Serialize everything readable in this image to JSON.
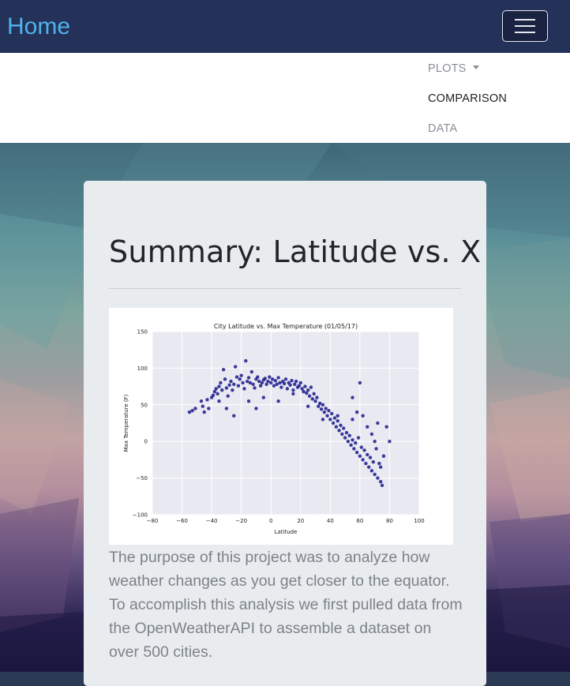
{
  "navbar": {
    "brand": "Home",
    "toggler_icon": "hamburger-icon",
    "menu": [
      {
        "label": "PLOTS",
        "dropdown": true
      },
      {
        "label": "COMPARISON",
        "dropdown": false
      },
      {
        "label": "DATA",
        "dropdown": false
      }
    ]
  },
  "main": {
    "title": "Summary: Latitude vs. X",
    "description": "The purpose of this project was to analyze how weather changes as you get closer to the equator. To accomplish this analysis we first pulled data from the OpenWeatherAPI to assemble a dataset on over 500 cities."
  },
  "colors": {
    "navbar": "#243159",
    "brand": "#4fb3ea",
    "card": "#e9ecef",
    "points": "#1a1a8c",
    "plot_bg": "#e9e9f1"
  },
  "chart_data": {
    "type": "scatter",
    "title": "City Latitude vs. Max Temperature (01/05/17)",
    "xlabel": "Latitude",
    "ylabel": "Max Temperature (F)",
    "xlim": [
      -80,
      100
    ],
    "ylim": [
      -100,
      150
    ],
    "xticks": [
      -80,
      -60,
      -40,
      -20,
      0,
      20,
      40,
      60,
      80,
      100
    ],
    "yticks": [
      -100,
      -50,
      0,
      50,
      100,
      150
    ],
    "grid": true,
    "series": [
      {
        "points": [
          [
            -55,
            40
          ],
          [
            -53,
            42
          ],
          [
            -51,
            45
          ],
          [
            -47,
            55
          ],
          [
            -46,
            48
          ],
          [
            -45,
            40
          ],
          [
            -43,
            57
          ],
          [
            -42,
            45
          ],
          [
            -40,
            60
          ],
          [
            -39,
            63
          ],
          [
            -38,
            68
          ],
          [
            -37,
            72
          ],
          [
            -36,
            65
          ],
          [
            -35,
            75
          ],
          [
            -34,
            80
          ],
          [
            -33,
            70
          ],
          [
            -32,
            98
          ],
          [
            -31,
            85
          ],
          [
            -30,
            73
          ],
          [
            -29,
            62
          ],
          [
            -28,
            77
          ],
          [
            -27,
            82
          ],
          [
            -26,
            70
          ],
          [
            -25,
            78
          ],
          [
            -24,
            102
          ],
          [
            -23,
            88
          ],
          [
            -22,
            76
          ],
          [
            -21,
            85
          ],
          [
            -20,
            90
          ],
          [
            -19,
            80
          ],
          [
            -18,
            72
          ],
          [
            -17,
            110
          ],
          [
            -16,
            82
          ],
          [
            -15,
            87
          ],
          [
            -14,
            80
          ],
          [
            -13,
            95
          ],
          [
            -12,
            78
          ],
          [
            -11,
            73
          ],
          [
            -10,
            85
          ],
          [
            -9,
            88
          ],
          [
            -8,
            82
          ],
          [
            -7,
            76
          ],
          [
            -6,
            80
          ],
          [
            -5,
            84
          ],
          [
            -4,
            86
          ],
          [
            -3,
            78
          ],
          [
            -2,
            82
          ],
          [
            -1,
            88
          ],
          [
            0,
            80
          ],
          [
            1,
            85
          ],
          [
            2,
            76
          ],
          [
            3,
            83
          ],
          [
            4,
            78
          ],
          [
            5,
            87
          ],
          [
            6,
            80
          ],
          [
            7,
            74
          ],
          [
            8,
            82
          ],
          [
            9,
            79
          ],
          [
            10,
            85
          ],
          [
            11,
            72
          ],
          [
            12,
            80
          ],
          [
            13,
            77
          ],
          [
            14,
            83
          ],
          [
            15,
            70
          ],
          [
            16,
            78
          ],
          [
            17,
            82
          ],
          [
            18,
            74
          ],
          [
            19,
            76
          ],
          [
            20,
            80
          ],
          [
            21,
            72
          ],
          [
            22,
            68
          ],
          [
            23,
            75
          ],
          [
            24,
            66
          ],
          [
            25,
            70
          ],
          [
            26,
            62
          ],
          [
            27,
            74
          ],
          [
            28,
            58
          ],
          [
            29,
            65
          ],
          [
            30,
            55
          ],
          [
            31,
            60
          ],
          [
            32,
            48
          ],
          [
            33,
            52
          ],
          [
            34,
            44
          ],
          [
            35,
            50
          ],
          [
            36,
            40
          ],
          [
            37,
            45
          ],
          [
            38,
            35
          ],
          [
            39,
            42
          ],
          [
            40,
            30
          ],
          [
            41,
            38
          ],
          [
            42,
            25
          ],
          [
            43,
            32
          ],
          [
            44,
            20
          ],
          [
            45,
            28
          ],
          [
            46,
            15
          ],
          [
            47,
            22
          ],
          [
            48,
            10
          ],
          [
            49,
            18
          ],
          [
            50,
            5
          ],
          [
            51,
            12
          ],
          [
            52,
            0
          ],
          [
            53,
            8
          ],
          [
            54,
            -5
          ],
          [
            55,
            2
          ],
          [
            56,
            -10
          ],
          [
            57,
            -2
          ],
          [
            58,
            -15
          ],
          [
            59,
            5
          ],
          [
            60,
            -20
          ],
          [
            61,
            -8
          ],
          [
            62,
            -25
          ],
          [
            63,
            -12
          ],
          [
            64,
            -30
          ],
          [
            65,
            -18
          ],
          [
            66,
            -35
          ],
          [
            67,
            -22
          ],
          [
            68,
            -40
          ],
          [
            69,
            -28
          ],
          [
            70,
            -45
          ],
          [
            71,
            -10
          ],
          [
            72,
            -50
          ],
          [
            73,
            -30
          ],
          [
            74,
            -55
          ],
          [
            75,
            -60
          ],
          [
            76,
            -20
          ],
          [
            -30,
            45
          ],
          [
            -25,
            35
          ],
          [
            -35,
            55
          ],
          [
            -15,
            55
          ],
          [
            -10,
            45
          ],
          [
            -5,
            60
          ],
          [
            5,
            55
          ],
          [
            15,
            65
          ],
          [
            25,
            48
          ],
          [
            35,
            30
          ],
          [
            45,
            35
          ],
          [
            55,
            30
          ],
          [
            58,
            40
          ],
          [
            62,
            35
          ],
          [
            65,
            20
          ],
          [
            68,
            10
          ],
          [
            70,
            0
          ],
          [
            72,
            25
          ],
          [
            74,
            -35
          ],
          [
            78,
            20
          ],
          [
            80,
            0
          ],
          [
            60,
            80
          ],
          [
            55,
            60
          ]
        ]
      }
    ]
  }
}
